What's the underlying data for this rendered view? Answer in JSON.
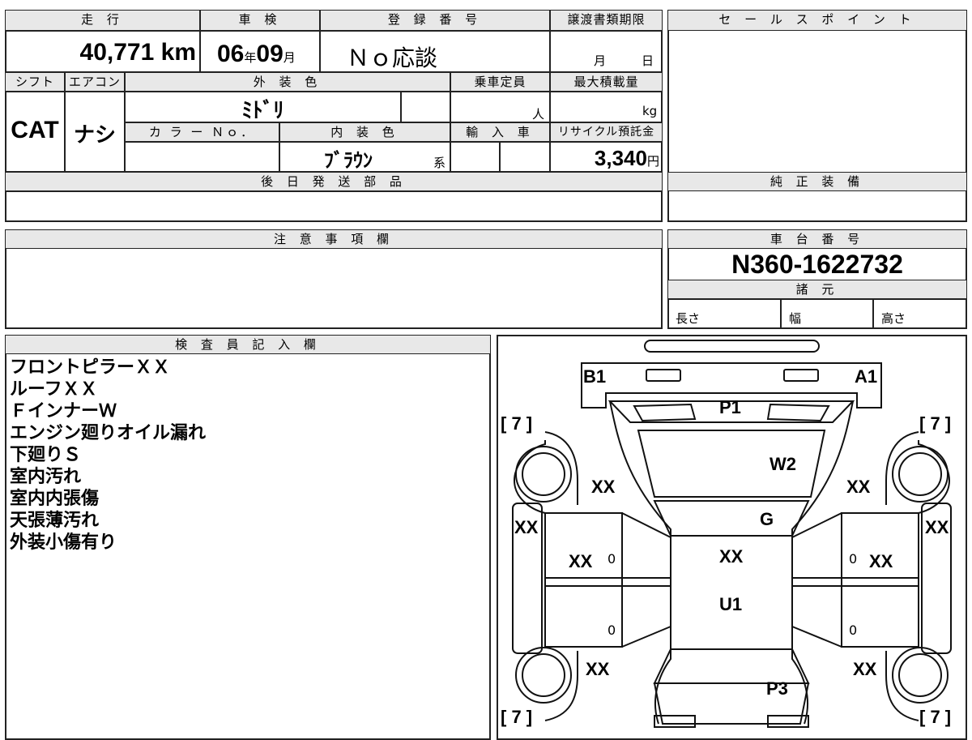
{
  "top_table": {
    "mileage_label": "走 行",
    "mileage_value": "40,771 km",
    "inspection_label": "車 検",
    "inspection_year": "06",
    "inspection_year_unit": "年",
    "inspection_month": "09",
    "inspection_month_unit": "月",
    "registration_label": "登 録 番 号",
    "registration_value": "Ｎｏ応談",
    "transfer_label": "譲渡書類期限",
    "transfer_month_unit": "月",
    "transfer_day_unit": "日",
    "shift_label": "シフト",
    "shift_value": "CAT",
    "aircon_label": "エアコン",
    "aircon_value": "ナシ",
    "exterior_color_label": "外 装 色",
    "exterior_color_value": "ﾐﾄﾞﾘ",
    "capacity_label": "乗車定員",
    "capacity_unit": "人",
    "max_load_label": "最大積載量",
    "max_load_unit": "kg",
    "color_no_label": "カ ラ ー Ｎｏ．",
    "interior_color_label": "内 装 色",
    "interior_color_value": "ﾌﾞﾗｳﾝ",
    "interior_color_suffix": "系",
    "import_label": "輸 入 車",
    "recycle_label": "リサイクル預託金",
    "recycle_value": "3,340",
    "recycle_unit": "円",
    "later_parts_label": "後 日 発 送 部 品"
  },
  "sales_point": {
    "label": "セ ー ル ス ポ イ ン ト"
  },
  "genuine_equipment": {
    "label": "純 正 装 備"
  },
  "notes": {
    "label": "注 意 事 項 欄"
  },
  "chassis": {
    "label": "車 台 番 号",
    "value": "N360-1622732",
    "specs_label": "諸 元",
    "length_label": "長さ",
    "width_label": "幅",
    "height_label": "高さ"
  },
  "inspector": {
    "label": "検 査 員 記 入 欄",
    "lines": [
      "フロントピラーＸＸ",
      "ルーフＸＸ",
      "ＦインナーＷ",
      "エンジン廻りオイル漏れ",
      "下廻りＳ",
      "室内汚れ",
      "室内内張傷",
      "天張薄汚れ",
      "外装小傷有り"
    ]
  },
  "diagram": {
    "marks": {
      "b1": "B1",
      "a1": "A1",
      "p1": "P1",
      "w2": "W2",
      "g": "G",
      "xx_left_fender": "XX",
      "xx_right_fender": "XX",
      "xx_left_pillar": "XX",
      "xx_right_pillar": "XX",
      "xx_left_door": "XX",
      "xx_right_door": "XX",
      "xx_roof": "XX",
      "u1": "U1",
      "xx_left_rear": "XX",
      "xx_right_rear": "XX",
      "p3": "P3",
      "zero": "0",
      "seven_bracket": "[ 7 ]"
    }
  }
}
